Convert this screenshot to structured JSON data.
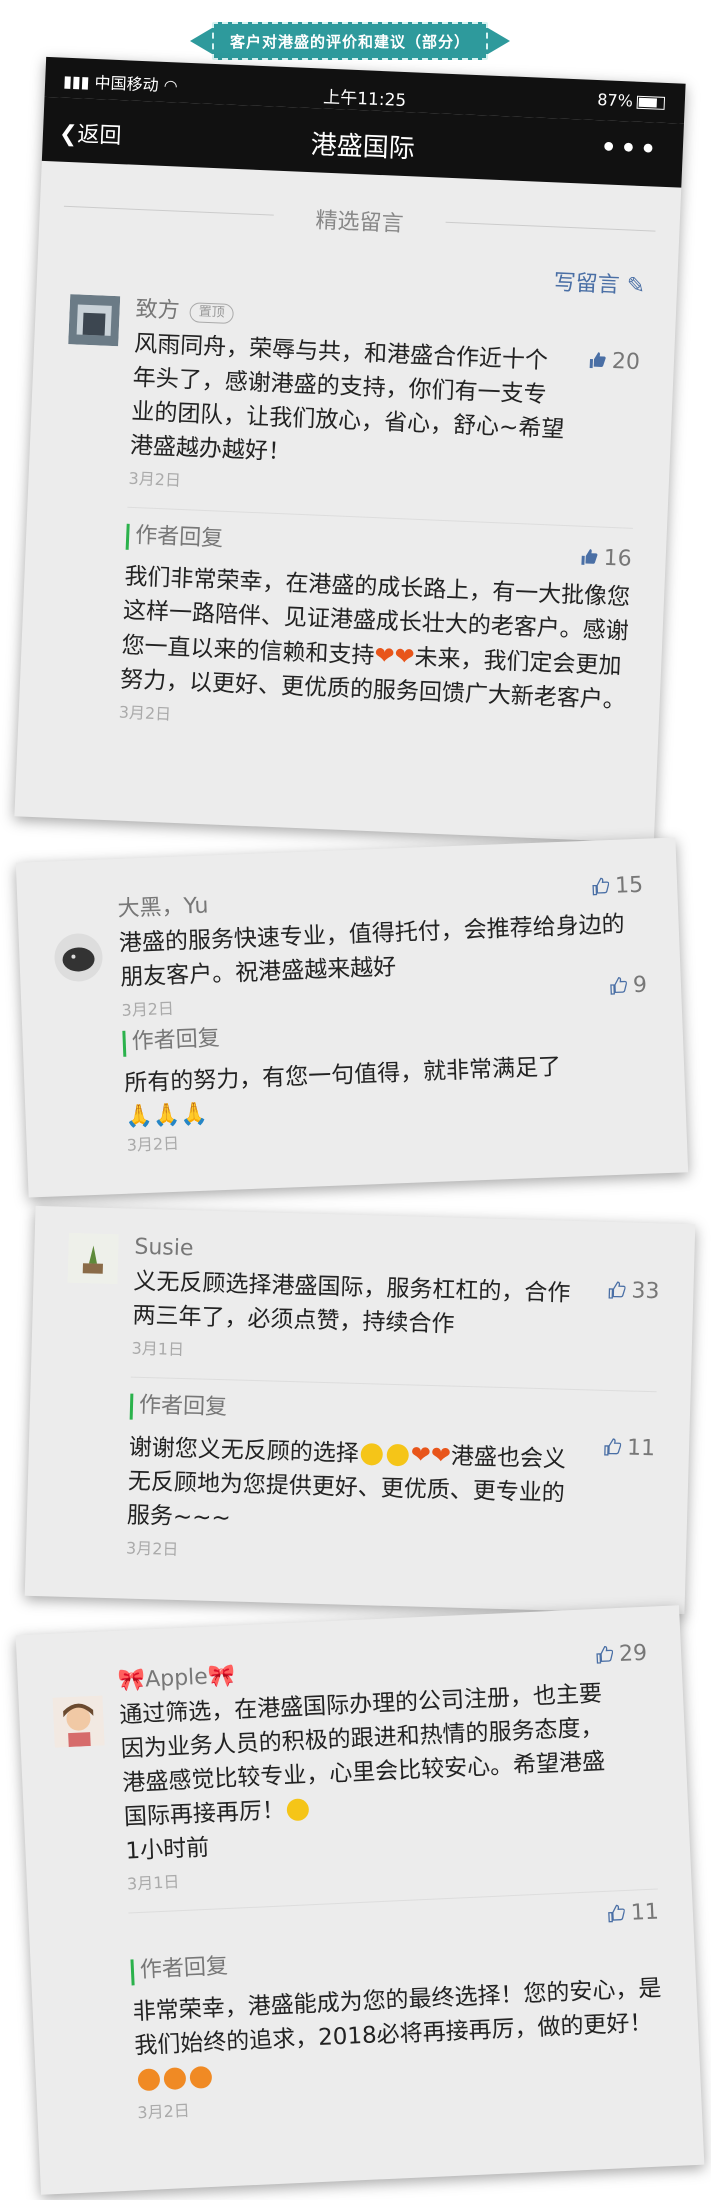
{
  "banner": {
    "text": "客户对港盛的评价和建议（部分）"
  },
  "status_bar": {
    "carrier": "中国移动",
    "time": "上午11:25",
    "battery": "87%"
  },
  "nav": {
    "back_label": "返回",
    "title": "港盛国际",
    "more": "•••"
  },
  "section": {
    "title": "精选留言",
    "write_label": "写留言"
  },
  "colors": {
    "accent": "#2bb24c",
    "banner": "#2e9a9c",
    "link": "#4a6fa5"
  },
  "comments": [
    {
      "name": "致方",
      "tag": "置顶",
      "likes": "20",
      "text": "风雨同舟，荣辱与共，和港盛合作近十个年头了，感谢港盛的支持，你们有一支专业的团队，让我们放心，省心，舒心~希望港盛越办越好！",
      "date": "3月2日",
      "reply": {
        "label": "作者回复",
        "likes": "16",
        "text_a": "我们非常荣幸，在港盛的成长路上，有一大批像您这样一路陪伴、见证港盛成长壮大的老客户。感谢您一直以来的信赖和支持",
        "text_b": "未来，我们定会更加努力，以更好、更优质的服务回馈广大新老客户。",
        "date": "3月2日"
      }
    },
    {
      "name": "大黑，Yu",
      "likes": "15",
      "text": "港盛的服务快速专业，值得托付，会推荐给身边的朋友客户。祝港盛越来越好",
      "date": "3月2日",
      "reply": {
        "label": "作者回复",
        "likes": "9",
        "text": "所有的努力，有您一句值得，就非常满足了",
        "date": "3月2日"
      }
    },
    {
      "name": "Susie",
      "likes": "33",
      "text": "义无反顾选择港盛国际，服务杠杠的，合作两三年了，必须点赞，持续合作",
      "date": "3月1日",
      "reply": {
        "label": "作者回复",
        "likes": "11",
        "text_a": "谢谢您义无反顾的选择",
        "text_b": "港盛也会义无反顾地为您提供更好、更优质、更专业的服务~~~",
        "date": "3月2日"
      }
    },
    {
      "name": "Apple",
      "likes": "29",
      "text": "通过筛选，在港盛国际办理的公司注册，也主要因为业务人员的积极的跟进和热情的服务态度，港盛感觉比较专业，心里会比较安心。希望港盛国际再接再厉！",
      "time_ago": "1小时前",
      "date": "3月1日",
      "reply": {
        "label": "作者回复",
        "likes": "11",
        "text": "非常荣幸，港盛能成为您的最终选择！您的安心，是我们始终的追求，2018必将再接再厉，做的更好！",
        "date": "3月2日"
      }
    }
  ]
}
